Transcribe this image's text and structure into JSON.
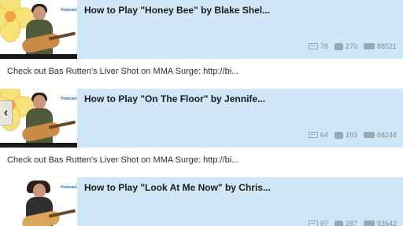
{
  "videos": [
    {
      "title": "How to Play \"Honey Bee\" by Blake Shel...",
      "comments": "78",
      "likes": "270",
      "views": "88521",
      "description": "Check out Bas Rutten's Liver Shot on MMA Surge: http://bi..."
    },
    {
      "title": "How to Play \"On The Floor\" by Jennife...",
      "comments": "64",
      "likes": "193",
      "views": "68248",
      "description": "Check out Bas Rutten's Liver Shot on MMA Surge: http://bi..."
    },
    {
      "title": "How to Play \"Look At Me Now\" by Chris...",
      "comments": "97",
      "likes": "287",
      "views": "93542",
      "description": ""
    }
  ],
  "thumbnail_brand": "Howcast",
  "side_arrow_icon": "chevron-left-icon",
  "colors": {
    "card_header_bg": "#cfe7f6",
    "title_text": "#1b1b1b",
    "stat_text": "#7a8a96"
  }
}
